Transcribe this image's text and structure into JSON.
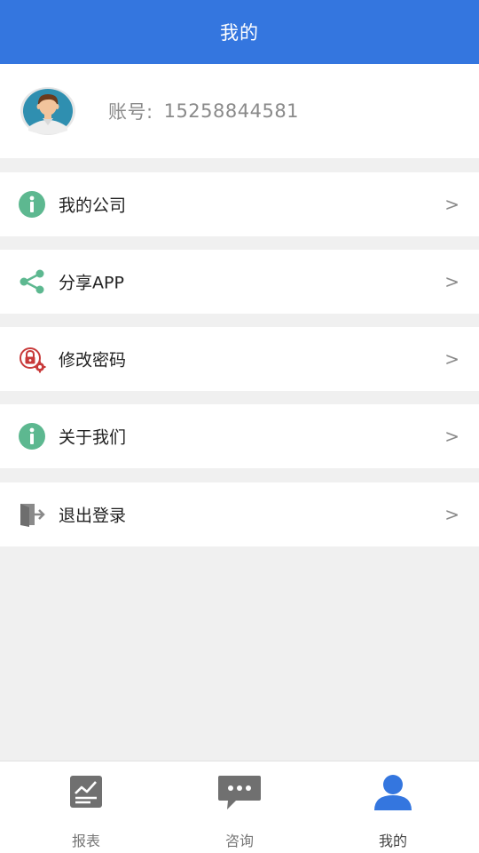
{
  "header": {
    "title": "我的"
  },
  "profile": {
    "account_label": "账号:",
    "account_value": "15258844581",
    "avatar_icon": "user-avatar-icon"
  },
  "menu": {
    "items": [
      {
        "label": "我的公司",
        "icon": "info-icon",
        "arrow": ">"
      },
      {
        "label": "分享APP",
        "icon": "share-icon",
        "arrow": ">"
      },
      {
        "label": "修改密码",
        "icon": "lock-settings-icon",
        "arrow": ">"
      },
      {
        "label": "关于我们",
        "icon": "info-icon",
        "arrow": ">"
      },
      {
        "label": "退出登录",
        "icon": "logout-icon",
        "arrow": ">"
      }
    ]
  },
  "tabbar": {
    "tabs": [
      {
        "label": "报表",
        "icon": "report-chart-icon"
      },
      {
        "label": "咨询",
        "icon": "chat-bubble-icon"
      },
      {
        "label": "我的",
        "icon": "person-icon",
        "active": true
      }
    ]
  },
  "colors": {
    "header": "#3476df",
    "info_icon": "#5db890",
    "share_icon": "#5db890",
    "lock_icon": "#c83a3a",
    "tab_active": "#3476df",
    "tab_inactive": "#707070"
  }
}
